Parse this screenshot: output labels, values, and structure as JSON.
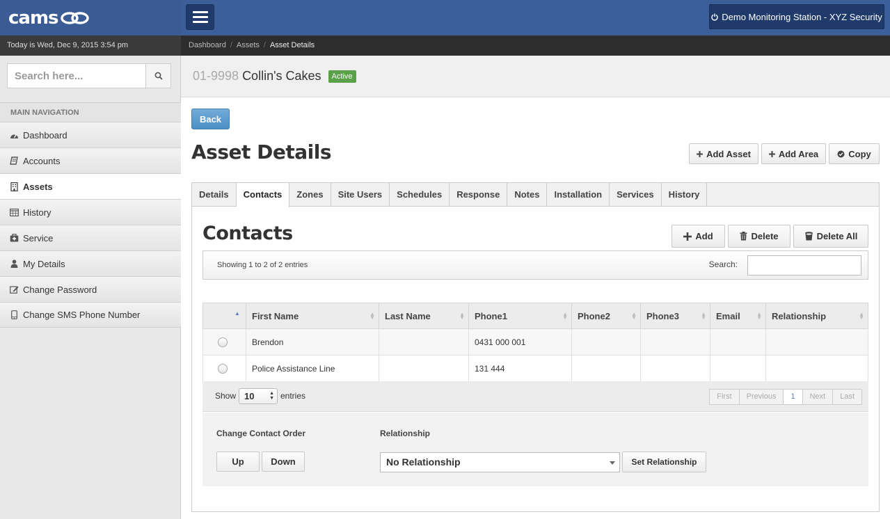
{
  "app": {
    "logo": "cams",
    "station_label": "Demo Monitoring Station - XYZ Security",
    "today": "Today is Wed, Dec 9, 2015 3:54 pm"
  },
  "breadcrumb": [
    "Dashboard",
    "Assets",
    "Asset Details"
  ],
  "sidebar": {
    "search_placeholder": "Search here...",
    "nav_header": "MAIN NAVIGATION",
    "items": [
      {
        "label": "Dashboard",
        "icon": "dashboard-icon"
      },
      {
        "label": "Accounts",
        "icon": "book-icon"
      },
      {
        "label": "Assets",
        "icon": "building-icon",
        "active": true
      },
      {
        "label": "History",
        "icon": "calendar-icon"
      },
      {
        "label": "Service",
        "icon": "medkit-icon"
      },
      {
        "label": "My Details",
        "icon": "user-icon"
      },
      {
        "label": "Change Password",
        "icon": "edit-icon"
      },
      {
        "label": "Change SMS Phone Number",
        "icon": "mobile-icon"
      }
    ]
  },
  "asset": {
    "number": "01-9998",
    "name": "Collin's Cakes",
    "status": "Active"
  },
  "page": {
    "back_label": "Back",
    "title": "Asset Details",
    "actions": {
      "add_asset": "Add Asset",
      "add_area": "Add Area",
      "copy": "Copy"
    }
  },
  "tabs": [
    "Details",
    "Contacts",
    "Zones",
    "Site Users",
    "Schedules",
    "Response",
    "Notes",
    "Installation",
    "Services",
    "History"
  ],
  "active_tab": "Contacts",
  "contacts": {
    "title": "Contacts",
    "add_label": "Add",
    "delete_label": "Delete",
    "delete_all_label": "Delete All",
    "info": "Showing 1 to 2 of 2 entries",
    "search_label": "Search:",
    "columns": [
      "",
      "First Name",
      "Last Name",
      "Phone1",
      "Phone2",
      "Phone3",
      "Email",
      "Relationship"
    ],
    "rows": [
      {
        "first": "Brendon",
        "last": "",
        "phone1": "0431 000 001",
        "phone2": "",
        "phone3": "",
        "email": "",
        "relationship": ""
      },
      {
        "first": "Police Assistance Line",
        "last": "",
        "phone1": "131 444",
        "phone2": "",
        "phone3": "",
        "email": "",
        "relationship": ""
      }
    ],
    "show_label": "Show",
    "page_size": "10",
    "entries_label": "entries",
    "pager": {
      "first": "First",
      "previous": "Previous",
      "current": "1",
      "next": "Next",
      "last": "Last"
    }
  },
  "order": {
    "label": "Change Contact Order",
    "up": "Up",
    "down": "Down",
    "relationship_label": "Relationship",
    "relationship_value": "No Relationship",
    "set_relationship": "Set Relationship"
  },
  "colors": {
    "topbar": "#3d5f99",
    "button_dark": "#1f3a6b",
    "active_badge": "#5aa14a",
    "back_button": "#4b8fc6"
  }
}
